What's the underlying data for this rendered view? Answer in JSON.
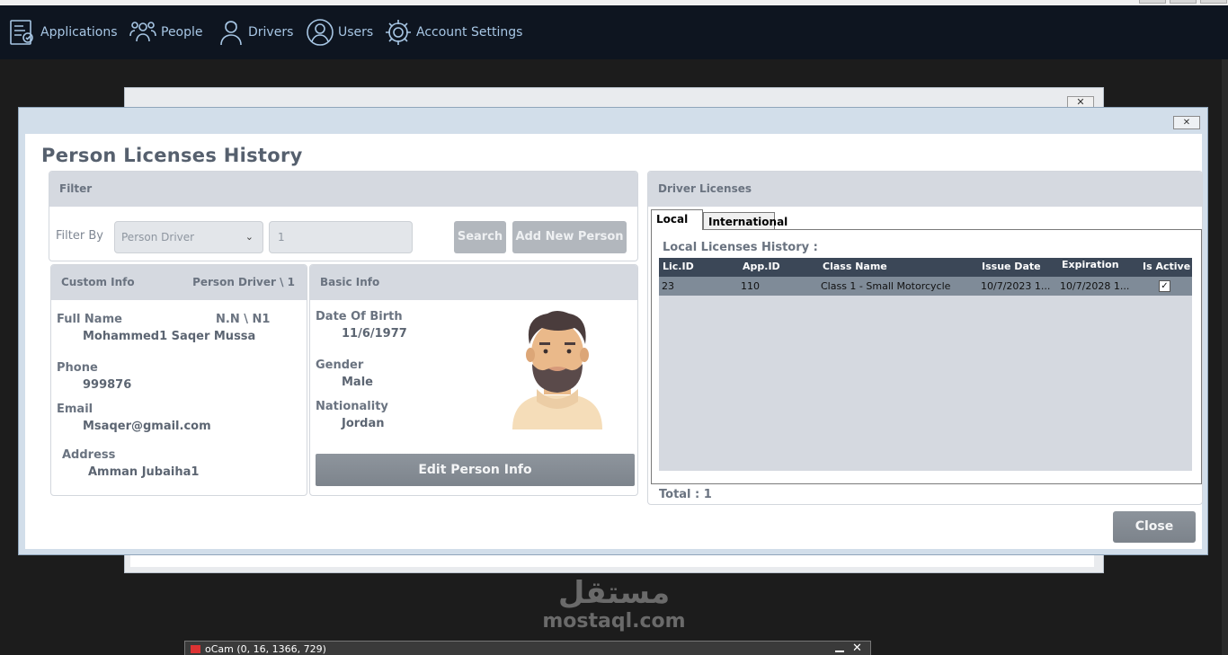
{
  "menu": [
    {
      "label": "Applications",
      "icon": "application-form-icon"
    },
    {
      "label": "People",
      "icon": "people-icon"
    },
    {
      "label": "Drivers",
      "icon": "driver-icon"
    },
    {
      "label": "Users",
      "icon": "user-circle-icon"
    },
    {
      "label": "Account Settings",
      "icon": "gear-icon"
    }
  ],
  "dialog": {
    "title": "Person Licenses History",
    "close_x": "✕",
    "close_button": "Close"
  },
  "filter": {
    "header": "Filter",
    "filter_by_label": "Filter By",
    "filter_by_value": "Person Driver",
    "search_value": "1",
    "search_button": "Search",
    "add_new_button": "Add New Person"
  },
  "custom_info": {
    "header": "Custom Info",
    "header_right": "Person Driver \\ 1",
    "full_name_label": "Full Name",
    "nn_label": "N.N \\ N1",
    "full_name": "Mohammed1 Saqer Mussa",
    "phone_label": "Phone",
    "phone": "999876",
    "email_label": "Email",
    "email": "Msaqer@gmail.com",
    "address_label": "Address",
    "address": "Amman Jubaiha1"
  },
  "basic_info": {
    "header": "Basic Info",
    "dob_label": "Date Of Birth",
    "dob": "11/6/1977",
    "gender_label": "Gender",
    "gender": "Male",
    "nationality_label": "Nationality",
    "nationality": "Jordan",
    "edit_button": "Edit Person Info"
  },
  "driver_licenses": {
    "header": "Driver Licenses",
    "tabs": [
      "Local",
      "International"
    ],
    "history_title": "Local Licenses History :",
    "columns": [
      "Lic.ID",
      "App.ID",
      "Class Name",
      "Issue Date",
      "Expiration",
      "Is Active"
    ],
    "rows": [
      {
        "lic_id": "23",
        "app_id": "110",
        "class_name": "Class 1 - Small Motorcycle",
        "issue_date": "10/7/2023 1...",
        "expiration": "10/7/2028 1...",
        "is_active": "✓"
      }
    ],
    "total": "Total : 1"
  },
  "watermark": {
    "arabic": "مستقل",
    "latin": "mostaql.com"
  },
  "taskbar": {
    "title": "oCam (0, 16, 1366, 729)"
  },
  "colors": {
    "menu_bg": "#0e1520",
    "menu_text": "#a7c6e4",
    "grid_header": "#3b4757",
    "grid_selected_row": "#7f8b98"
  }
}
